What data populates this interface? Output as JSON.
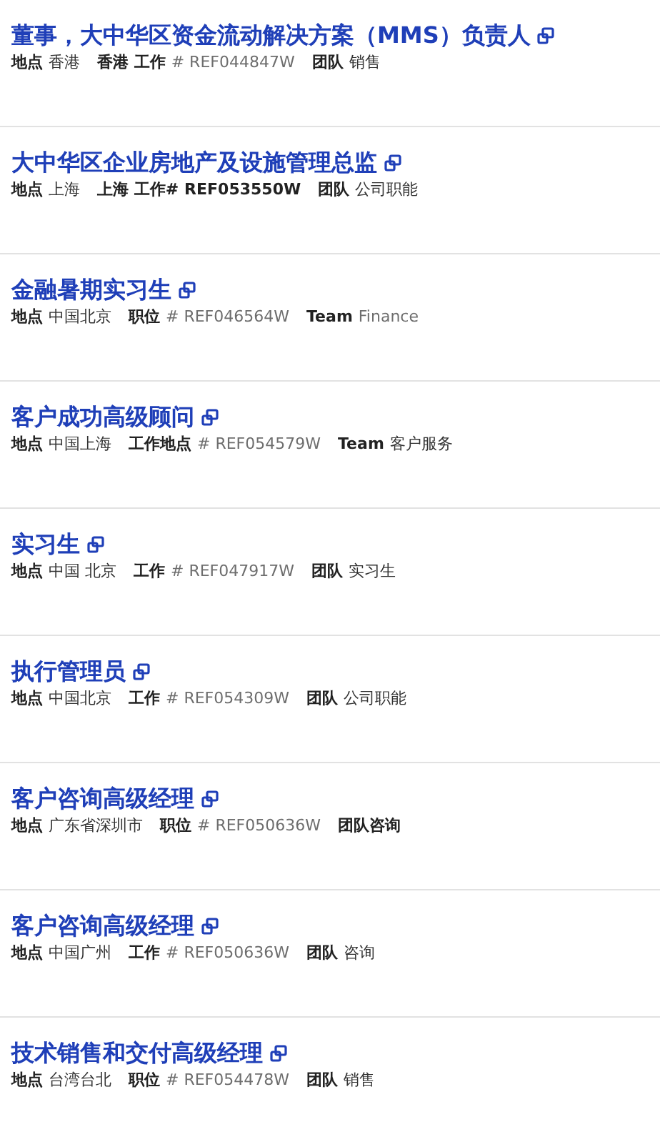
{
  "jobs": [
    {
      "title": "董事，大中华区资金流动解决方案（MMS）负责人",
      "fields": [
        {
          "label": "地点",
          "value": "香港",
          "kind": "place"
        },
        {
          "label": "香港 工作",
          "value": "# REF044847W",
          "kind": "reference"
        },
        {
          "label": "团队",
          "value": "销售",
          "kind": "team"
        }
      ]
    },
    {
      "title": "大中华区企业房地产及设施管理总监",
      "fields": [
        {
          "label": "地点",
          "value": "上海",
          "kind": "place"
        },
        {
          "label": "上海 工作#",
          "value": "REF053550W",
          "kind": "emphasis"
        },
        {
          "label": "团队",
          "value": "公司职能",
          "kind": "team"
        }
      ]
    },
    {
      "title": "金融暑期实习生",
      "fields": [
        {
          "label": "地点",
          "value": "中国北京",
          "kind": "place"
        },
        {
          "label": "职位",
          "value": "# REF046564W",
          "kind": "reference"
        },
        {
          "label": "Team",
          "value": "Finance",
          "kind": "note"
        }
      ]
    },
    {
      "title": "客户成功高级顾问",
      "fields": [
        {
          "label": "地点",
          "value": "中国上海",
          "kind": "place"
        },
        {
          "label": "工作地点",
          "value": "# REF054579W",
          "kind": "reference"
        },
        {
          "label": "Team",
          "value": "客户服务",
          "kind": "team"
        }
      ]
    },
    {
      "title": "实习生",
      "fields": [
        {
          "label": "地点",
          "value": "中国 北京",
          "kind": "place"
        },
        {
          "label": "工作",
          "value": "# REF047917W",
          "kind": "reference"
        },
        {
          "label": "团队",
          "value": "实习生",
          "kind": "team"
        }
      ]
    },
    {
      "title": "执行管理员",
      "fields": [
        {
          "label": "地点",
          "value": "中国北京",
          "kind": "place"
        },
        {
          "label": "工作",
          "value": "# REF054309W",
          "kind": "reference"
        },
        {
          "label": "团队",
          "value": "公司职能",
          "kind": "team"
        }
      ]
    },
    {
      "title": "客户咨询高级经理",
      "fields": [
        {
          "label": "地点",
          "value": "广东省深圳市",
          "kind": "place"
        },
        {
          "label": "职位",
          "value": "# REF050636W",
          "kind": "reference"
        },
        {
          "label": "团队咨询"
        }
      ]
    },
    {
      "title": "客户咨询高级经理",
      "fields": [
        {
          "label": "地点",
          "value": "中国广州",
          "kind": "place"
        },
        {
          "label": "工作",
          "value": "# REF050636W",
          "kind": "reference"
        },
        {
          "label": "团队",
          "value": "咨询",
          "kind": "team"
        }
      ]
    },
    {
      "title": "技术销售和交付高级经理",
      "fields": [
        {
          "label": "地点",
          "value": "台湾台北",
          "kind": "place"
        },
        {
          "label": "职位",
          "value": "# REF054478W",
          "kind": "reference"
        },
        {
          "label": "团队",
          "value": "销售",
          "kind": "team"
        }
      ]
    }
  ]
}
